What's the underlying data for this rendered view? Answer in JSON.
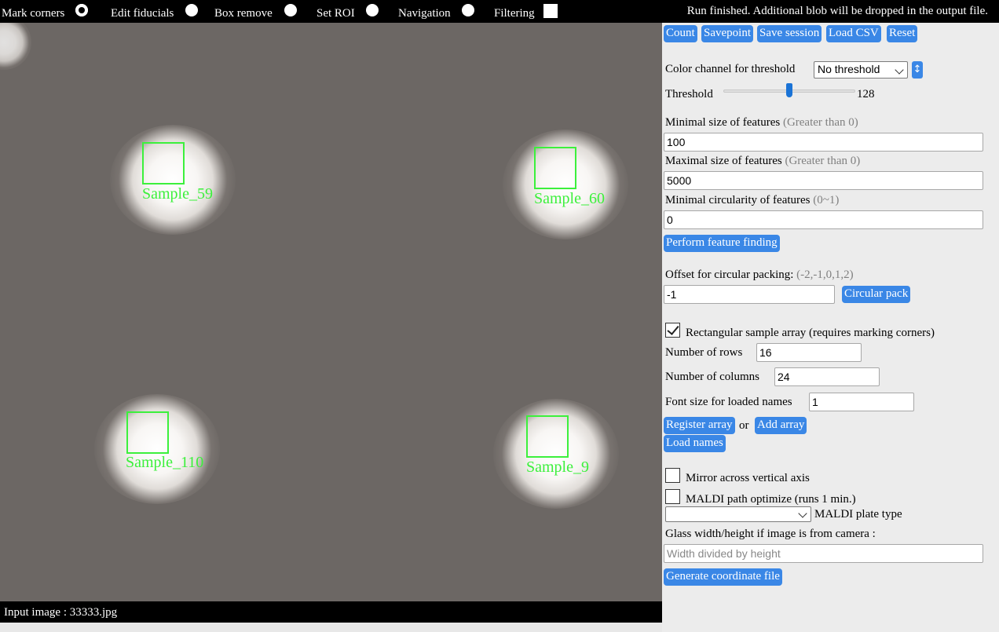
{
  "toolbar": {
    "modes": [
      {
        "label": "Mark corners",
        "checked": true
      },
      {
        "label": "Edit fiducials",
        "checked": false
      },
      {
        "label": "Box remove",
        "checked": false
      },
      {
        "label": "Set ROI",
        "checked": false
      },
      {
        "label": "Navigation",
        "checked": false
      }
    ],
    "filtering_label": "Filtering",
    "filtering_checked": false
  },
  "status": "Run finished. Additional blob will be dropped in the output file.",
  "image": {
    "samples": [
      {
        "name": "Sample_59"
      },
      {
        "name": "Sample_60"
      },
      {
        "name": "Sample_110"
      },
      {
        "name": "Sample_9"
      }
    ],
    "footer": "Input image : 33333.jpg"
  },
  "actions": {
    "count": "Count",
    "savepoint": "Savepoint",
    "save_session": "Save session",
    "load_csv": "Load CSV",
    "reset": "Reset"
  },
  "threshold": {
    "channel_label": "Color channel for threshold",
    "channel_value": "No threshold",
    "sort_icon": "↕",
    "threshold_label": "Threshold",
    "threshold_value": "128",
    "threshold_fraction": 0.5
  },
  "features": {
    "min_size_label": "Minimal size of features",
    "min_size_hint": "(Greater than 0)",
    "min_size_value": "100",
    "max_size_label": "Maximal size of features",
    "max_size_hint": "(Greater than 0)",
    "max_size_value": "5000",
    "circularity_label": "Minimal circularity of features",
    "circularity_hint": "(0~1)",
    "circularity_value": "0",
    "perform_button": "Perform feature finding"
  },
  "packing": {
    "offset_label": "Offset for circular packing:",
    "offset_hint": "(-2,-1,0,1,2)",
    "offset_value": "-1",
    "circular_pack_button": "Circular pack"
  },
  "array": {
    "rect_label": "Rectangular sample array (requires marking corners)",
    "rect_checked": true,
    "rows_label": "Number of rows",
    "rows_value": "16",
    "cols_label": "Number of columns",
    "cols_value": "24",
    "font_label": "Font size for loaded names",
    "font_value": "1",
    "register_button": "Register array",
    "or_text": "or",
    "add_button": "Add array",
    "load_names_button": "Load names"
  },
  "output": {
    "mirror_label": "Mirror across vertical axis",
    "mirror_checked": false,
    "maldi_label": "MALDI path optimize (runs 1 min.)",
    "maldi_checked": false,
    "plate_value": "",
    "plate_label": "MALDI plate type",
    "glass_label": "Glass width/height if image is from camera :",
    "glass_placeholder": "Width divided by height",
    "generate_button": "Generate coordinate file"
  },
  "colors": {
    "button": "#3a87e6",
    "sample_outline": "#3cf03c",
    "image_background": "#6c6764"
  }
}
